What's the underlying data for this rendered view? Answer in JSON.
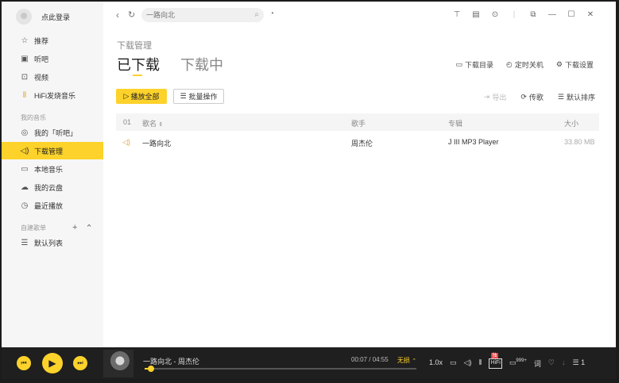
{
  "sidebar": {
    "login_label": "点此登录",
    "items_top": [
      {
        "label": "推荐",
        "icon": "star-icon"
      },
      {
        "label": "听吧",
        "icon": "radio-icon"
      },
      {
        "label": "视频",
        "icon": "video-icon"
      },
      {
        "label": "HiFi发烧音乐",
        "icon": "hifi-icon"
      }
    ],
    "my_music_title": "我的音乐",
    "items_my": [
      {
        "label": "我的「听吧」",
        "icon": "radio-circle-icon"
      },
      {
        "label": "下载管理",
        "icon": "speaker-icon",
        "active": true
      },
      {
        "label": "本地音乐",
        "icon": "monitor-icon"
      },
      {
        "label": "我的云盘",
        "icon": "cloud-icon"
      },
      {
        "label": "最近播放",
        "icon": "clock-icon"
      }
    ],
    "playlist_title": "自建歌单",
    "playlist_items": [
      {
        "label": "默认列表",
        "icon": "list-icon"
      }
    ]
  },
  "topbar": {
    "search_placeholder": "一路向北"
  },
  "main": {
    "subtitle": "下载管理",
    "tab_downloaded": "已下载",
    "tab_downloading": "下载中",
    "actions": {
      "download_dir": "下载目录",
      "shutdown_timer": "定时关机",
      "download_settings": "下载设置"
    },
    "play_all": "播放全部",
    "batch_ops": "批量操作",
    "tools": {
      "export": "导出",
      "transfer": "传歌",
      "sort": "默认排序"
    },
    "table": {
      "col_index": "01",
      "col_song": "歌名",
      "col_artist": "歌手",
      "col_album": "专辑",
      "col_size": "大小",
      "rows": [
        {
          "song": "一路向北",
          "artist": "周杰伦",
          "album": "J III MP3 Player",
          "size": "33.80 MB"
        }
      ]
    }
  },
  "player": {
    "song_title": "一路向北 - 周杰伦",
    "time": "00:07 / 04:55",
    "quality": "无损",
    "progress": 0.024,
    "speed": "1.0x",
    "hifi_label": "HiFi",
    "badge": "独",
    "comments": "999+",
    "lyrics": "词",
    "playlist_count": "1",
    "colors": {
      "accent": "#fdd22a",
      "badge": "#e94040"
    }
  }
}
